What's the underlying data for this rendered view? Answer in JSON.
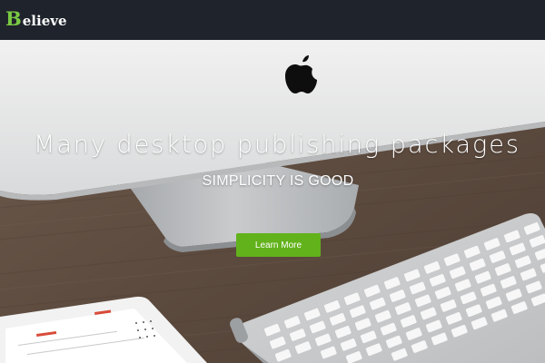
{
  "navbar": {
    "brand_initial": "B",
    "brand_rest": "elieve"
  },
  "hero": {
    "headline": "Many desktop publishing packages",
    "tagline": "SIMPLICITY IS GOOD",
    "cta_label": "Learn More"
  },
  "colors": {
    "navbar_bg": "#1f232c",
    "brand_accent": "#7ac943",
    "cta_bg": "#62b21b"
  },
  "icons": {
    "brand": "apple-logo-icon"
  }
}
